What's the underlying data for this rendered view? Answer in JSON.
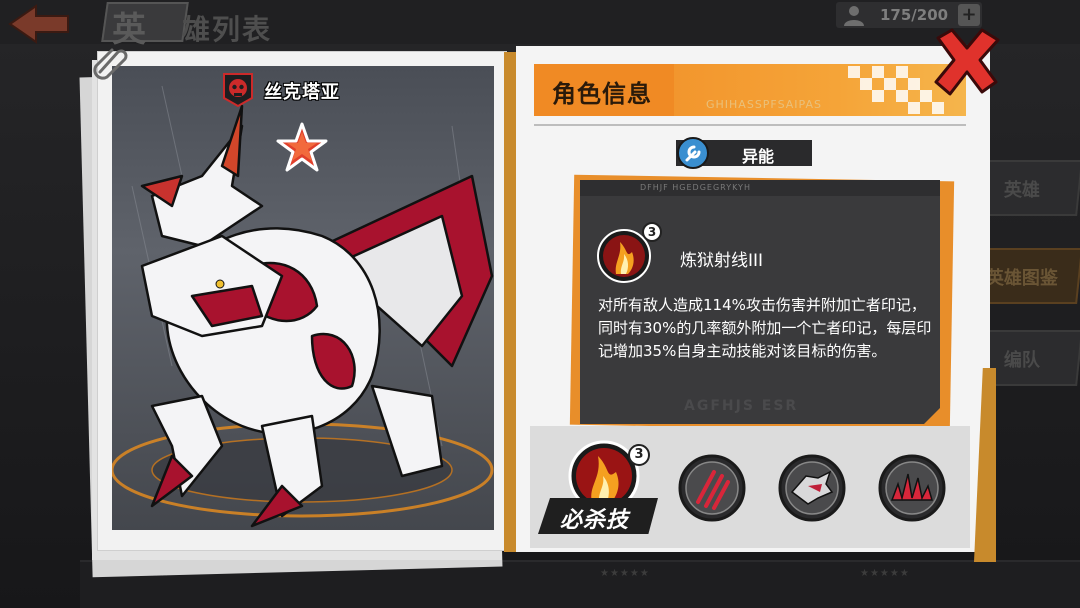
{
  "background": {
    "title": "英雄列表",
    "title_first": "英",
    "title_rest": "雄列表",
    "resource_count": "175/200",
    "resource_plus": "+",
    "side_tabs": [
      "英雄",
      "英雄图鉴",
      "编队"
    ],
    "bottom_stars": "★★★★★"
  },
  "hero": {
    "name": "丝克塔亚",
    "faction_icon": "skull-emblem-icon",
    "rank_icon": "red-star-icon"
  },
  "panel": {
    "title": "角色信息",
    "header_code": "GHIHASSPFSAIPAS",
    "type_label": "异能",
    "type_icon": "wrench-icon"
  },
  "skill_detail": {
    "box_code": "DFHJF HGEDGEGRYKYH",
    "level": "3",
    "name": "炼狱射线III",
    "description": "对所有敌人造成114%攻击伤害并附加亡者印记，同时有30%的几率额外附加一个亡者印记，每层印记增加35%自身主动技能对该目标的伤害。",
    "watermark": "AGFHJS ESR"
  },
  "skills": [
    {
      "id": "ultimate",
      "label": "必杀技",
      "level": "3",
      "icon": "fire-burst-icon",
      "selected": true
    },
    {
      "id": "skill-2",
      "icon": "claw-slash-icon",
      "selected": false
    },
    {
      "id": "skill-3",
      "icon": "dragon-head-icon",
      "selected": false
    },
    {
      "id": "skill-4",
      "icon": "spike-eruption-icon",
      "selected": false
    }
  ],
  "colors": {
    "accent_orange": "#f08a24",
    "panel_bg": "#f4f4f4",
    "skill_box_bg": "#3a3a3c",
    "close_red": "#e0322c",
    "dragon_crimson": "#a8122e"
  }
}
